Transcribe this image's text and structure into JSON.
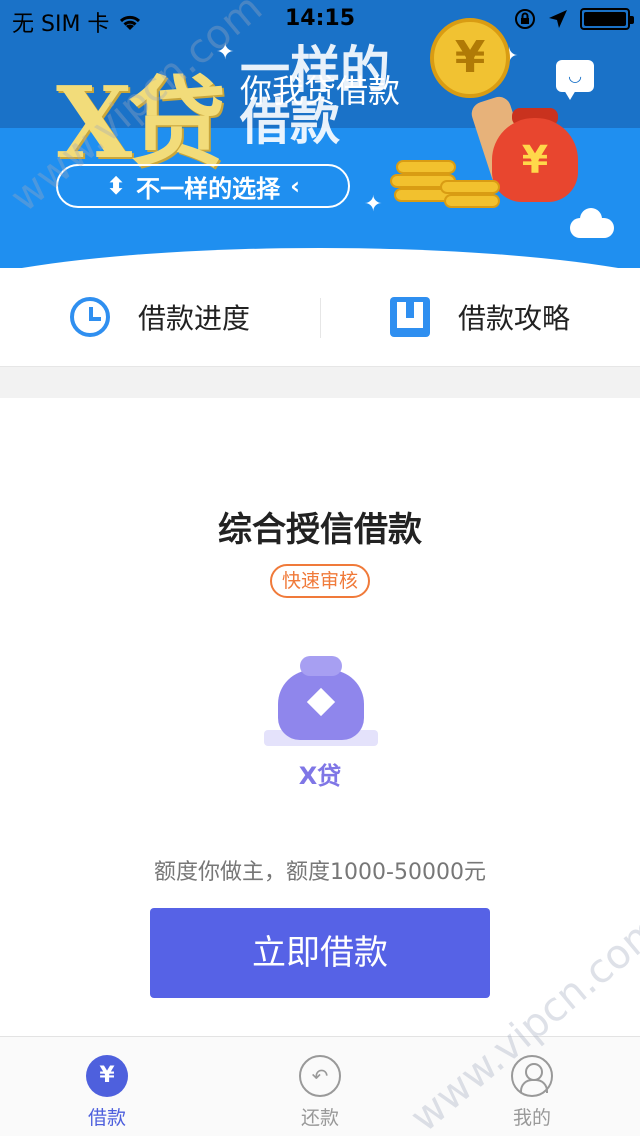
{
  "status_bar": {
    "carrier": "无 SIM 卡",
    "time": "14:15"
  },
  "header": {
    "title": "你我贷借款",
    "logo_mark": "X贷",
    "logo_sub_line1": "一样的",
    "logo_sub_line2": "借款",
    "tagline": "不一样的选择",
    "coin_symbol": "¥",
    "message_icon": "chat-bubble-smile-icon"
  },
  "quick_links": [
    {
      "label": "借款进度",
      "icon": "clock-icon"
    },
    {
      "label": "借款攻略",
      "icon": "book-icon"
    }
  ],
  "product": {
    "title": "综合授信借款",
    "badge": "快速审核",
    "name": "X贷",
    "limit_text": "额度你做主，额度1000-50000元",
    "cta_label": "立即借款"
  },
  "tab_bar": {
    "items": [
      {
        "label": "借款",
        "icon": "yen-icon",
        "glyph": "¥",
        "active": true
      },
      {
        "label": "还款",
        "icon": "repay-icon",
        "glyph": "↶",
        "active": false
      },
      {
        "label": "我的",
        "icon": "user-icon",
        "active": false
      }
    ]
  },
  "watermark": {
    "text": "www.vipcn.com"
  },
  "colors": {
    "header_blue": "#1f8ff0",
    "primary": "#5662e6",
    "badge_orange": "#f07a3a",
    "product_purple": "#8f86ec"
  }
}
